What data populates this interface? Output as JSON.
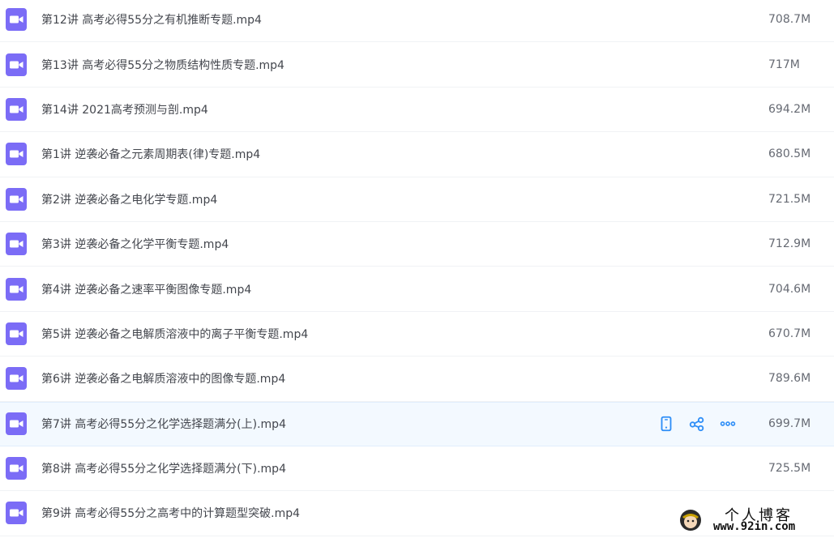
{
  "colors": {
    "icon_bg": "#7b6cf6",
    "action_blue": "#2e8ef7",
    "highlight_bg": "#f3f9ff"
  },
  "file_icon_name": "video-file-icon",
  "files": [
    {
      "name": "第12讲 高考必得55分之有机推断专题.mp4",
      "size": "708.7M"
    },
    {
      "name": "第13讲 高考必得55分之物质结构性质专题.mp4",
      "size": "717M"
    },
    {
      "name": "第14讲 2021高考预测与剖.mp4",
      "size": "694.2M"
    },
    {
      "name": "第1讲 逆袭必备之元素周期表(律)专题.mp4",
      "size": "680.5M"
    },
    {
      "name": "第2讲 逆袭必备之电化学专题.mp4",
      "size": "721.5M"
    },
    {
      "name": "第3讲 逆袭必备之化学平衡专题.mp4",
      "size": "712.9M"
    },
    {
      "name": "第4讲 逆袭必备之速率平衡图像专题.mp4",
      "size": "704.6M"
    },
    {
      "name": "第5讲 逆袭必备之电解质溶液中的离子平衡专题.mp4",
      "size": "670.7M"
    },
    {
      "name": "第6讲 逆袭必备之电解质溶液中的图像专题.mp4",
      "size": "789.6M"
    },
    {
      "name": "第7讲 高考必得55分之化学选择题满分(上).mp4",
      "size": "699.7M"
    },
    {
      "name": "第8讲 高考必得55分之化学选择题满分(下).mp4",
      "size": "725.5M"
    },
    {
      "name": "第9讲 高考必得55分之高考中的计算题型突破.mp4",
      "size": ""
    }
  ],
  "highlighted_row": 9,
  "row_actions": [
    {
      "icon": "phone-icon",
      "name": "send-to-phone-button"
    },
    {
      "icon": "share-icon",
      "name": "share-button"
    },
    {
      "icon": "more-icon",
      "name": "more-button"
    }
  ],
  "watermark": {
    "title": "个人博客",
    "url": "www.92in.com"
  }
}
